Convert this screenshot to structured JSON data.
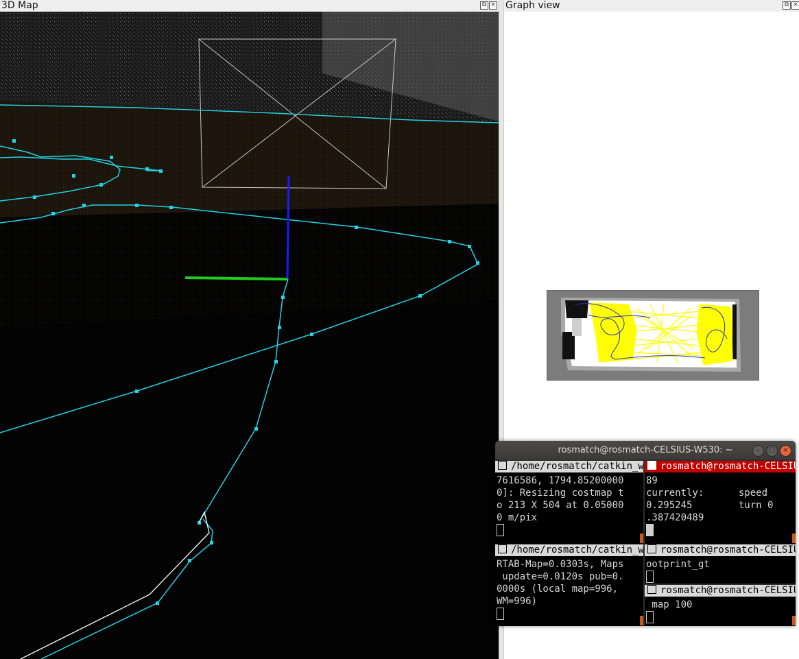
{
  "map3d": {
    "title": "3D Map"
  },
  "graph": {
    "title": "Graph view"
  },
  "terminal": {
    "title": "rosmatch@rosmatch-CELSIUS-W530: ~",
    "panes": [
      {
        "header": "/home/rosmatch/catkin_ws",
        "lines": [
          "7616586, 1794.85200000",
          "0]: Resizing costmap t",
          "o 213 X 504 at 0.05000",
          "0 m/pix"
        ]
      },
      {
        "header": "rosmatch@rosmatch-CELSIU",
        "lines": [
          "89",
          "currently:      speed",
          "0.295245        turn 0",
          ".387420489"
        ]
      },
      {
        "header": "/home/rosmatch/catkin_ws",
        "lines": [
          "RTAB-Map=0.0303s, Maps",
          " update=0.0120s pub=0.",
          "0000s (local map=996,",
          "WM=996)"
        ]
      },
      {
        "header": "rosmatch@rosmatch-CELSIU",
        "lines": [
          "ootprint_gt"
        ]
      },
      {
        "header": "rosmatch@rosmatch-CELSIU",
        "lines": [
          " map 100"
        ]
      }
    ]
  },
  "colors": {
    "trajectory": "#22d3e6",
    "axis_z": "#1a1aff",
    "axis_y": "#1ecc1e",
    "graph_links": "#ffff00",
    "active_pane": "#c30000"
  }
}
